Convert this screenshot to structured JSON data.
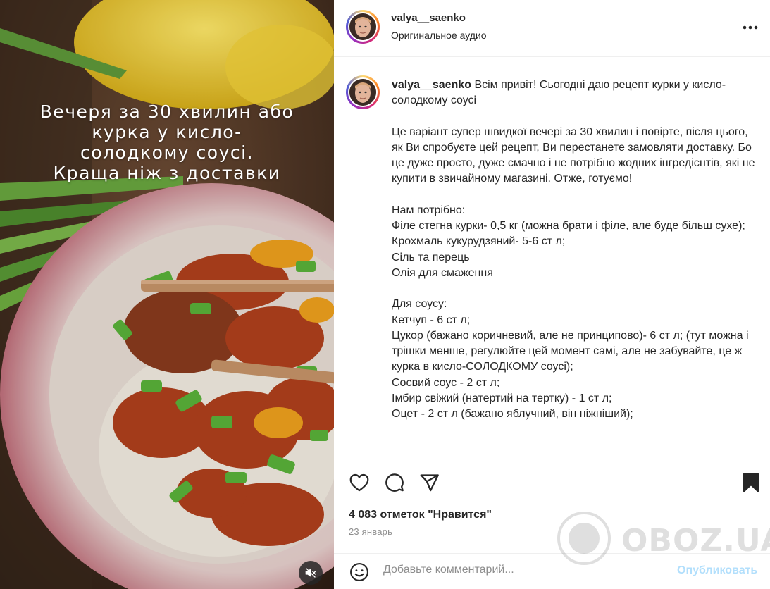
{
  "media": {
    "overlay_lines": [
      "Вечеря за 30 хвилин або",
      "курка у кисло-",
      "солодкому соусі.",
      "Краща ніж з доставки"
    ],
    "mute_icon": "speaker-muted-icon"
  },
  "header": {
    "username": "valya__saenko",
    "audio": "Оригинальное аудио",
    "more_icon": "more-horizontal-icon"
  },
  "caption": {
    "username": "valya__saenko",
    "paragraphs": [
      "Всім привіт! Сьогодні даю рецепт курки у кисло-солодкому соусі",
      "Це варіант супер швидкої вечері за 30 хвилин і повірте, після цього, як Ви спробуєте цей рецепт, Ви перестанете замовляти доставку. Бо це дуже просто, дуже смачно і не потрібно жодних інгредієнтів, які не купити в звичайному магазині. Отже, готуємо!",
      "Нам потрібно:\nФіле стегна курки- 0,5 кг (можна брати і філе, але буде більш сухе);\nКрохмаль кукурудзяний- 5-6 ст л;\nСіль та перець\nОлія для смаження",
      "Для соусу:\nКетчуп - 6 ст л;\nЦукор (бажано коричневий, але не принципово)- 6 ст л; (тут можна і трішки менше, регулюйте цей момент самі, але не забувайте, це ж курка в кисло-СОЛОДКОМУ соусі);\nСоєвий соус - 2 ст л;\nІмбир свіжий (натертий на тертку) - 1 ст л;\nОцет - 2 ст л (бажано яблучний, він ніжніший);"
    ]
  },
  "actions": {
    "like_icon": "heart-icon",
    "comment_icon": "comment-icon",
    "share_icon": "share-icon",
    "save_icon": "bookmark-icon",
    "likes_text": "4 083 отметок \"Нравится\"",
    "date_text": "23 январь"
  },
  "comment": {
    "emoji_icon": "emoji-icon",
    "placeholder": "Добавьте комментарий...",
    "publish_label": "Опубликовать"
  },
  "watermark": {
    "text": "OBOZ.UA"
  },
  "colors": {
    "text": "#262626",
    "muted": "#8e8e8e",
    "publish_disabled": "#b2dffc",
    "divider": "#efefef"
  }
}
